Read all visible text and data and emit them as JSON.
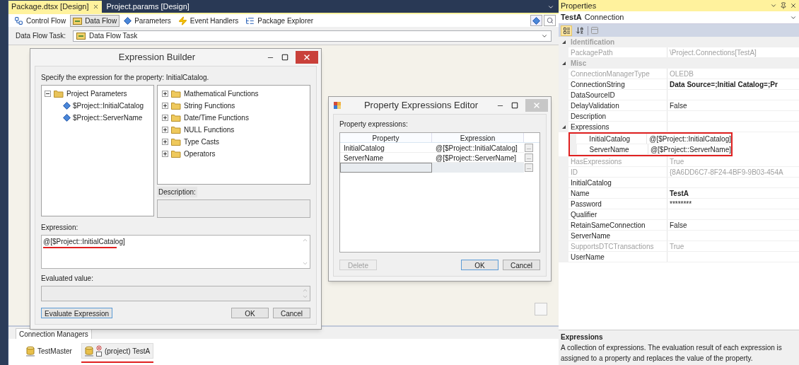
{
  "document_tabs": [
    {
      "label": "Package.dtsx [Design]",
      "selected": true
    },
    {
      "label": "Project.params [Design]",
      "selected": false
    }
  ],
  "designer_tabs": [
    {
      "label": "Control Flow",
      "kind": "control",
      "selected": false
    },
    {
      "label": "Data Flow",
      "kind": "data",
      "selected": true
    },
    {
      "label": "Parameters",
      "kind": "parameters",
      "selected": false
    },
    {
      "label": "Event Handlers",
      "kind": "events",
      "selected": false
    },
    {
      "label": "Package Explorer",
      "kind": "explorer",
      "selected": false
    }
  ],
  "task_selector": {
    "label": "Data Flow Task:",
    "value": "Data Flow Task"
  },
  "expression_builder": {
    "title": "Expression Builder",
    "prompt": "Specify the expression for the property: InitialCatalog.",
    "variables": [
      {
        "label": "Project Parameters",
        "expanded": true,
        "children": [
          {
            "label": "$Project::InitialCatalog"
          },
          {
            "label": "$Project::ServerName"
          }
        ]
      }
    ],
    "functions": [
      {
        "label": "Mathematical Functions",
        "expanded": false
      },
      {
        "label": "String Functions",
        "expanded": false
      },
      {
        "label": "Date/Time Functions",
        "expanded": false
      },
      {
        "label": "NULL Functions",
        "expanded": false
      },
      {
        "label": "Type Casts",
        "expanded": false
      },
      {
        "label": "Operators",
        "expanded": false
      }
    ],
    "description_label": "Description:",
    "expression_label": "Expression:",
    "expression": "@[$Project::InitialCatalog]",
    "expression_annotated": true,
    "evaluated_label": "Evaluated value:",
    "evaluate_button": "Evaluate Expression",
    "ok_button": "OK",
    "cancel_button": "Cancel"
  },
  "property_expressions_editor": {
    "title": "Property Expressions Editor",
    "list_label": "Property expressions:",
    "columns": [
      "Property",
      "Expression"
    ],
    "rows": [
      {
        "property": "InitialCatalog",
        "expression": "@[$Project::InitialCatalog]",
        "ellipsis": "...",
        "selected": false
      },
      {
        "property": "ServerName",
        "expression": "@[$Project::ServerName]",
        "ellipsis": "...",
        "selected": false
      },
      {
        "ellipsis": "...",
        "selected": true
      }
    ],
    "delete_button": {
      "label": "Delete",
      "disabled": true
    },
    "ok_button": "OK",
    "cancel_button": "Cancel"
  },
  "connection_managers": {
    "title": "Connection Managers",
    "items": [
      {
        "label": "TestMaster",
        "kind": "package",
        "annotated": false
      },
      {
        "label": "(project) TestA",
        "kind": "project",
        "annotated": true
      }
    ]
  },
  "properties": {
    "title": "Properties",
    "object_name": "TestA",
    "object_type": "Connection",
    "categorized_view": true,
    "categories": [
      {
        "name": "Identification",
        "expanded": true,
        "properties": [
          {
            "name": "PackagePath",
            "value": "\\Project.Connections[TestA]",
            "disabled": true,
            "modified": false
          }
        ]
      },
      {
        "name": "Misc",
        "expanded": true,
        "properties": [
          {
            "name": "ConnectionManagerType",
            "value": "OLEDB",
            "disabled": true,
            "modified": false
          },
          {
            "name": "ConnectionString",
            "value": "Data Source=;Initial Catalog=;Pr",
            "disabled": false,
            "modified": true
          },
          {
            "name": "DataSourceID",
            "disabled": false
          },
          {
            "name": "DelayValidation",
            "value": "False",
            "disabled": false,
            "modified": false
          },
          {
            "name": "Description",
            "disabled": false
          },
          {
            "name": "Expressions",
            "disabled": false,
            "expanded": true,
            "annotated": true,
            "children": [
              {
                "name": "InitialCatalog",
                "value": "@[$Project::InitialCatalog]",
                "disabled": false,
                "modified": false
              },
              {
                "name": "ServerName",
                "value": "@[$Project::ServerName]",
                "disabled": false,
                "modified": false
              }
            ]
          },
          {
            "name": "HasExpressions",
            "value": "True",
            "disabled": true,
            "modified": false
          },
          {
            "name": "ID",
            "value": "{8A6DD6C7-8F24-4BF9-9B03-454A",
            "disabled": true,
            "modified": false
          },
          {
            "name": "InitialCatalog",
            "disabled": false
          },
          {
            "name": "Name",
            "value": "TestA",
            "disabled": false,
            "modified": true
          },
          {
            "name": "Password",
            "value": "********",
            "disabled": false,
            "modified": false
          },
          {
            "name": "Qualifier",
            "disabled": false
          },
          {
            "name": "RetainSameConnection",
            "value": "False",
            "disabled": false,
            "modified": false
          },
          {
            "name": "ServerName",
            "disabled": false
          },
          {
            "name": "SupportsDTCTransactions",
            "value": "True",
            "disabled": true,
            "modified": false
          },
          {
            "name": "UserName",
            "disabled": false
          }
        ]
      }
    ],
    "description": {
      "title": "Expressions",
      "text": "A collection of expressions. The evaluation result of each expression is assigned to a property and replaces the value of the property."
    }
  }
}
